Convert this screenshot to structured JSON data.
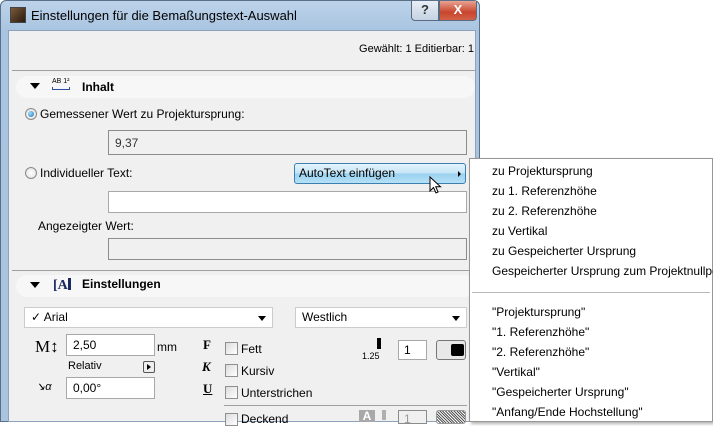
{
  "window": {
    "title": "Einstellungen für die Bemaßungstext-Auswahl",
    "help": "?",
    "close": "X"
  },
  "status": "Gewählt: 1 Editierbar: 1",
  "inhalt": {
    "title": "Inhalt",
    "icon_text": "AB 1²",
    "radio_measured": "Gemessener Wert zu Projektursprung:",
    "measured_value": "9,37",
    "radio_custom": "Individueller Text:",
    "autotext_button": "AutoText einfügen",
    "custom_text": "",
    "displayed_label": "Angezeigter Wert:",
    "displayed_value": ""
  },
  "einstellungen": {
    "title": "Einstellungen",
    "font": "✓ Arial",
    "script": "Westlich",
    "size": "2,50",
    "size_unit": "mm",
    "relativ": "Relativ",
    "angle": "0,00°",
    "bold_icon": "F",
    "italic_icon": "K",
    "underline_icon": "U",
    "bold": "Fett",
    "italic": "Kursiv",
    "underline": "Unterstrichen",
    "opaque": "Deckend",
    "pen_size": "1.25",
    "pen": "1",
    "fill_pen": "1",
    "fill_icon": "A"
  },
  "menu": {
    "items": [
      "zu Projektursprung",
      "zu 1. Referenzhöhe",
      "zu 2. Referenzhöhe",
      "zu Vertikal",
      "zu Gespeicherter Ursprung",
      "Gespeicherter Ursprung zum Projektnullpegel"
    ],
    "items2": [
      "\"Projektursprung\"",
      "\"1. Referenzhöhe\"",
      "\"2. Referenzhöhe\"",
      "\"Vertikal\"",
      "\"Gespeicherter Ursprung\"",
      "\"Anfang/Ende Hochstellung\""
    ]
  }
}
